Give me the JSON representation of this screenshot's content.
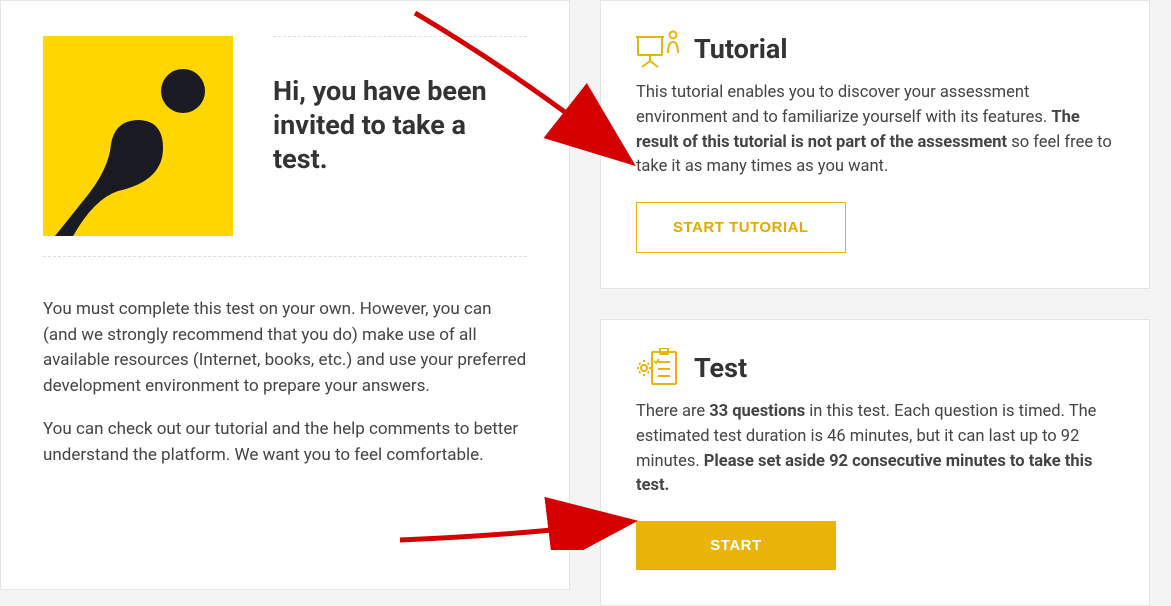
{
  "invite": {
    "heading": "Hi, you have been invited to take a test.",
    "para1": "You must complete this test on your own. However, you can (and we strongly recommend that you do) make use of all available resources (Internet, books, etc.) and use your preferred development environment to prepare your answers.",
    "para2": "You can check out our tutorial and the help comments to better understand the platform. We want you to feel comfortable."
  },
  "tutorial": {
    "title": "Tutorial",
    "desc_pre": "This tutorial enables you to discover your assessment environment and to familiarize yourself with its features. ",
    "desc_bold": "The result of this tutorial is not part of the assessment",
    "desc_post": " so feel free to take it as many times as you want.",
    "button": "START TUTORIAL"
  },
  "test": {
    "title": "Test",
    "desc_p1": "There are ",
    "questions_bold": "33 questions",
    "desc_p2": " in this test. Each question is timed. The estimated test duration is 46 minutes, but it can last up to 92 minutes. ",
    "reserve_bold": "Please set aside 92 consecutive minutes to take this test.",
    "button": "START"
  },
  "colors": {
    "brand_yellow": "#ffd600",
    "accent": "#eab308"
  }
}
